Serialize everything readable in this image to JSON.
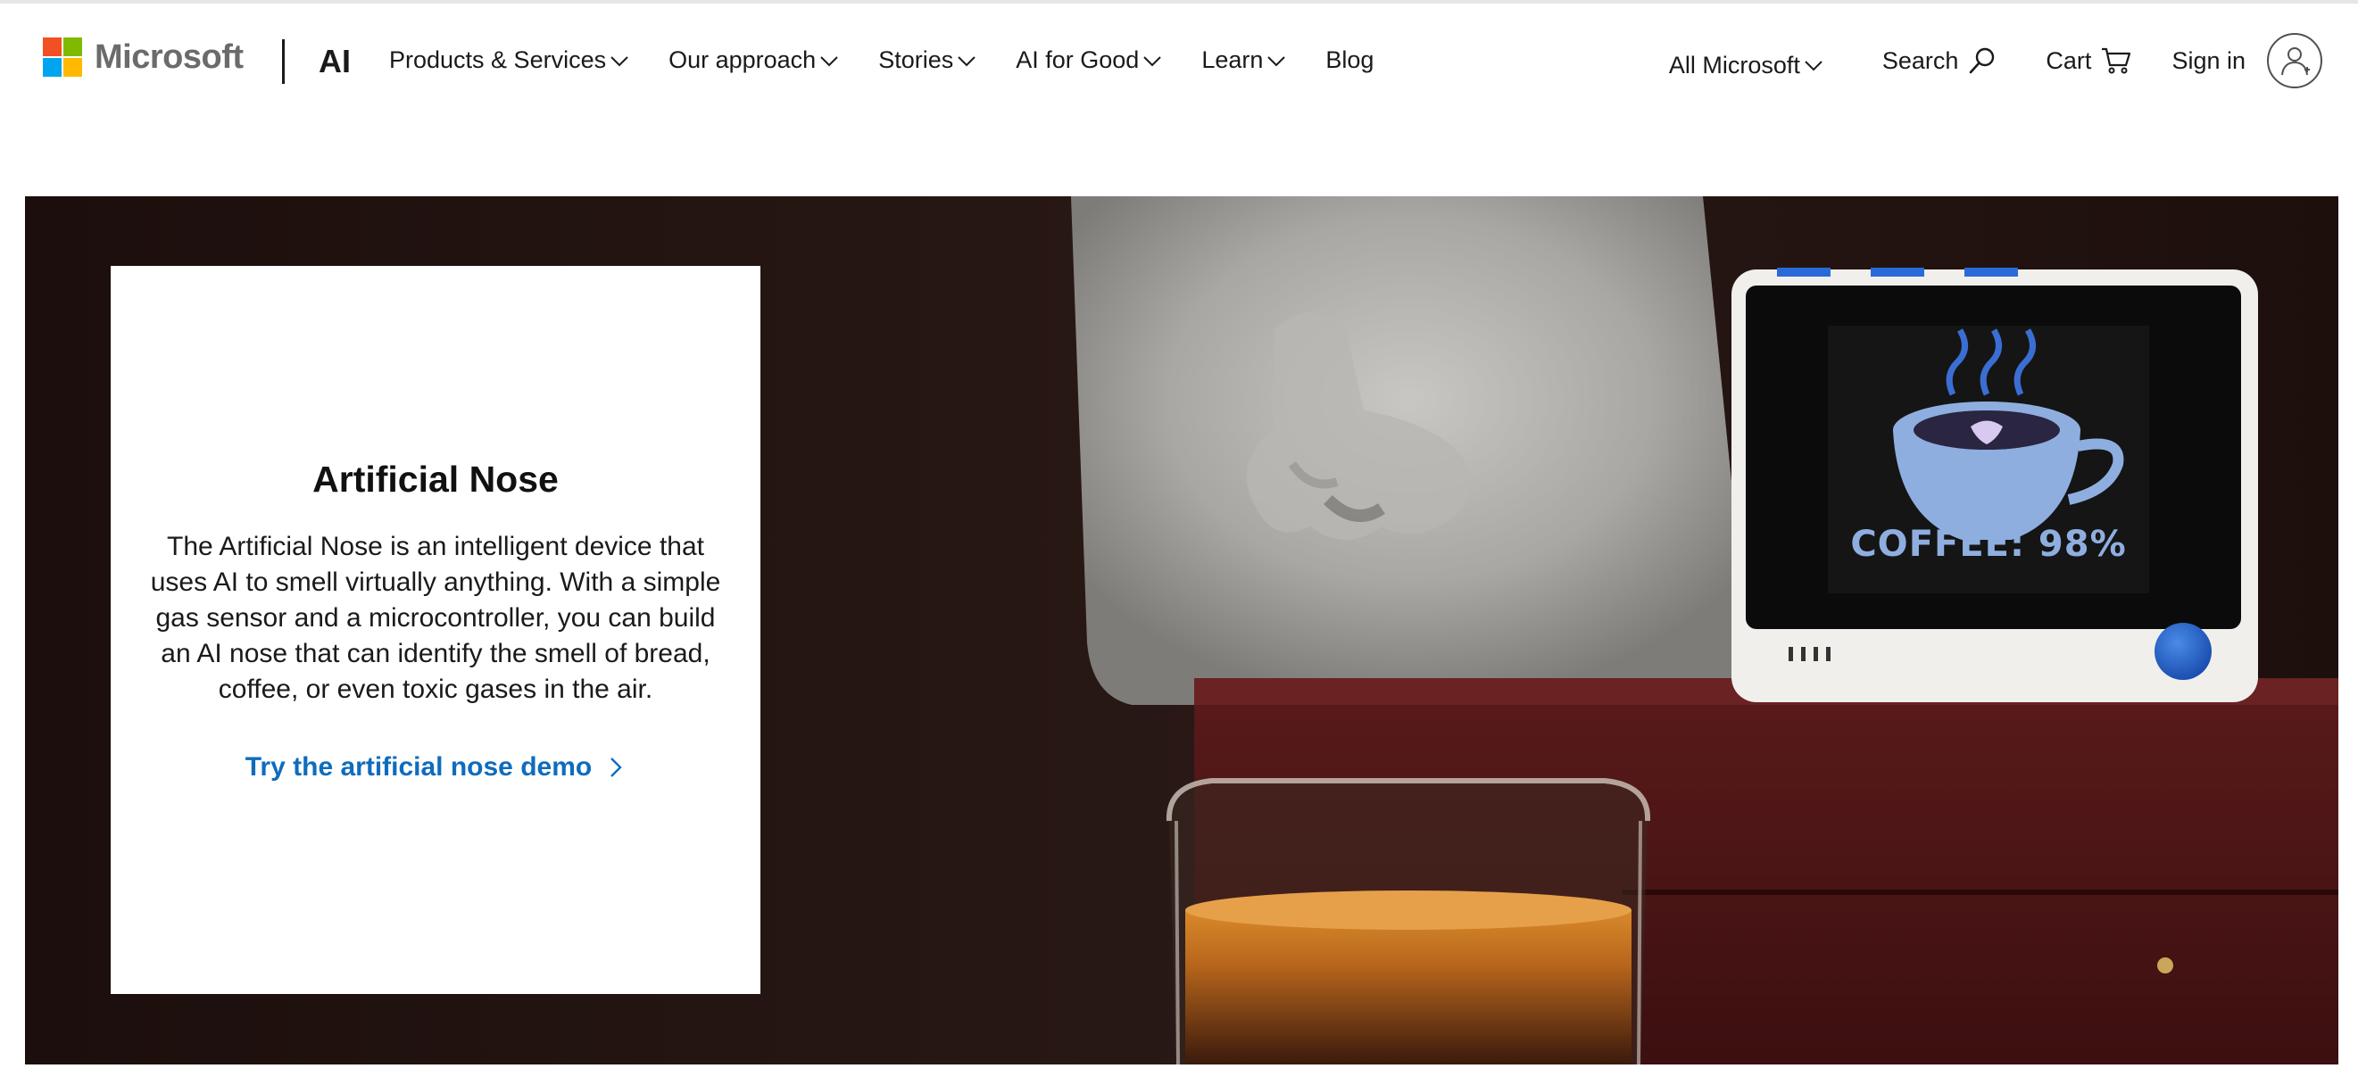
{
  "header": {
    "brand_name": "Microsoft",
    "section_label": "AI",
    "nav": [
      {
        "label": "Products & Services",
        "has_dropdown": true
      },
      {
        "label": "Our approach",
        "has_dropdown": true
      },
      {
        "label": "Stories",
        "has_dropdown": true
      },
      {
        "label": "AI for Good",
        "has_dropdown": true
      },
      {
        "label": "Learn",
        "has_dropdown": true
      },
      {
        "label": "Blog",
        "has_dropdown": false
      }
    ],
    "all_microsoft": "All Microsoft",
    "search": "Search",
    "cart": "Cart",
    "sign_in": "Sign in",
    "icons": {
      "search": "search-icon",
      "cart": "cart-icon",
      "avatar": "user-avatar-icon",
      "dropdown": "chevron-down-icon"
    }
  },
  "hero": {
    "title": "Artificial Nose",
    "description": "The Artificial Nose is an intelligent device that uses AI to smell virtually anything. With a simple gas sensor and a microcontroller, you can build an AI nose that can identify the smell of bread, coffee, or even toxic gases in the air.",
    "cta": "Try the artificial nose demo",
    "device_screen_text": "COFFEE: 98%"
  },
  "colors": {
    "link": "#0f6cbd",
    "logo_red": "#f25022",
    "logo_green": "#7fba00",
    "logo_blue": "#00a4ef",
    "logo_yellow": "#ffb900"
  }
}
